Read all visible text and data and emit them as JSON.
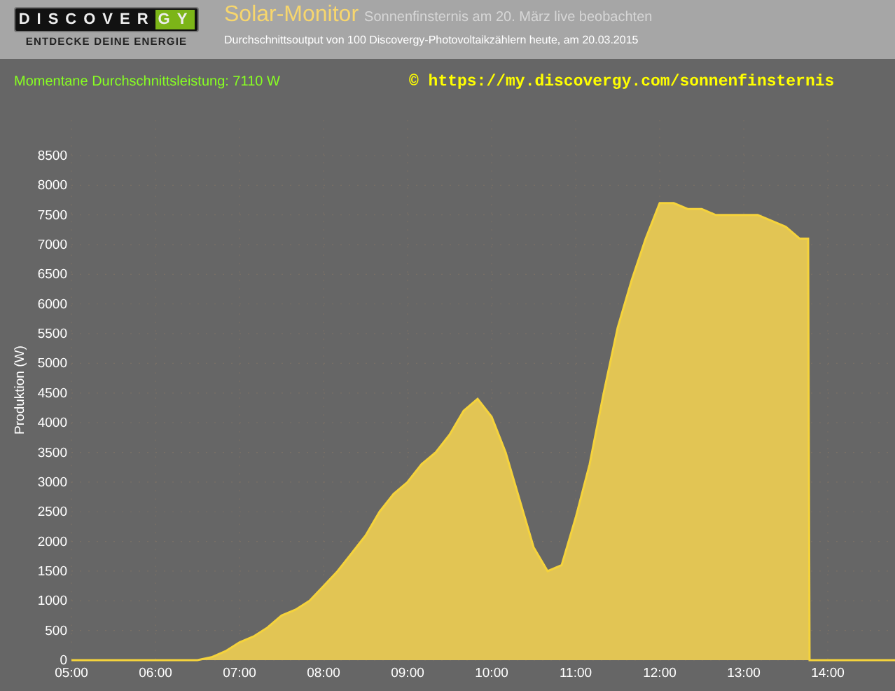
{
  "header": {
    "logo": {
      "word_main": "DISCOVER",
      "word_accent": "GY",
      "tagline": "ENTDECKE DEINE ENERGIE"
    },
    "title": "Solar-Monitor",
    "subtitle": "Sonnenfinsternis am 20. März live beobachten",
    "description": "Durchschnittsoutput von 100 Discovergy-Photovoltaikzählern heute, am 20.03.2015"
  },
  "info": {
    "current_power_label": "Momentane Durchschnittsleistung: 7110 W",
    "link": "© https://my.discovergy.com/sonnenfinsternis"
  },
  "chart_data": {
    "type": "area",
    "grid": true,
    "ylabel": "Produktion (W)",
    "x": [
      300,
      390,
      400,
      410,
      420,
      430,
      440,
      450,
      460,
      470,
      480,
      490,
      500,
      510,
      520,
      530,
      540,
      550,
      560,
      570,
      580,
      590,
      600,
      610,
      620,
      630,
      640,
      650,
      660,
      670,
      680,
      690,
      700,
      710,
      720,
      730,
      740,
      750,
      760,
      770,
      780,
      790,
      800,
      810,
      820,
      826,
      827,
      888
    ],
    "values": [
      0,
      0,
      50,
      150,
      300,
      400,
      550,
      750,
      850,
      1000,
      1250,
      1500,
      1800,
      2100,
      2500,
      2800,
      3000,
      3300,
      3500,
      3800,
      4200,
      4400,
      4100,
      3500,
      2700,
      1900,
      1500,
      1600,
      2400,
      3300,
      4500,
      5600,
      6400,
      7100,
      7700,
      7700,
      7600,
      7600,
      7500,
      7500,
      7500,
      7500,
      7400,
      7300,
      7100,
      7100,
      0,
      0
    ],
    "xlim": [
      300,
      888
    ],
    "ylim": [
      0,
      9100
    ],
    "xticks": [
      {
        "value": 300,
        "label": "05:00"
      },
      {
        "value": 360,
        "label": "06:00"
      },
      {
        "value": 420,
        "label": "07:00"
      },
      {
        "value": 480,
        "label": "08:00"
      },
      {
        "value": 540,
        "label": "09:00"
      },
      {
        "value": 600,
        "label": "10:00"
      },
      {
        "value": 660,
        "label": "11:00"
      },
      {
        "value": 720,
        "label": "12:00"
      },
      {
        "value": 780,
        "label": "13:00"
      },
      {
        "value": 840,
        "label": "14:00"
      }
    ],
    "yticks": [
      0,
      500,
      1000,
      1500,
      2000,
      2500,
      3000,
      3500,
      4000,
      4500,
      5000,
      5500,
      6000,
      6500,
      7000,
      7500,
      8000,
      8500
    ]
  }
}
